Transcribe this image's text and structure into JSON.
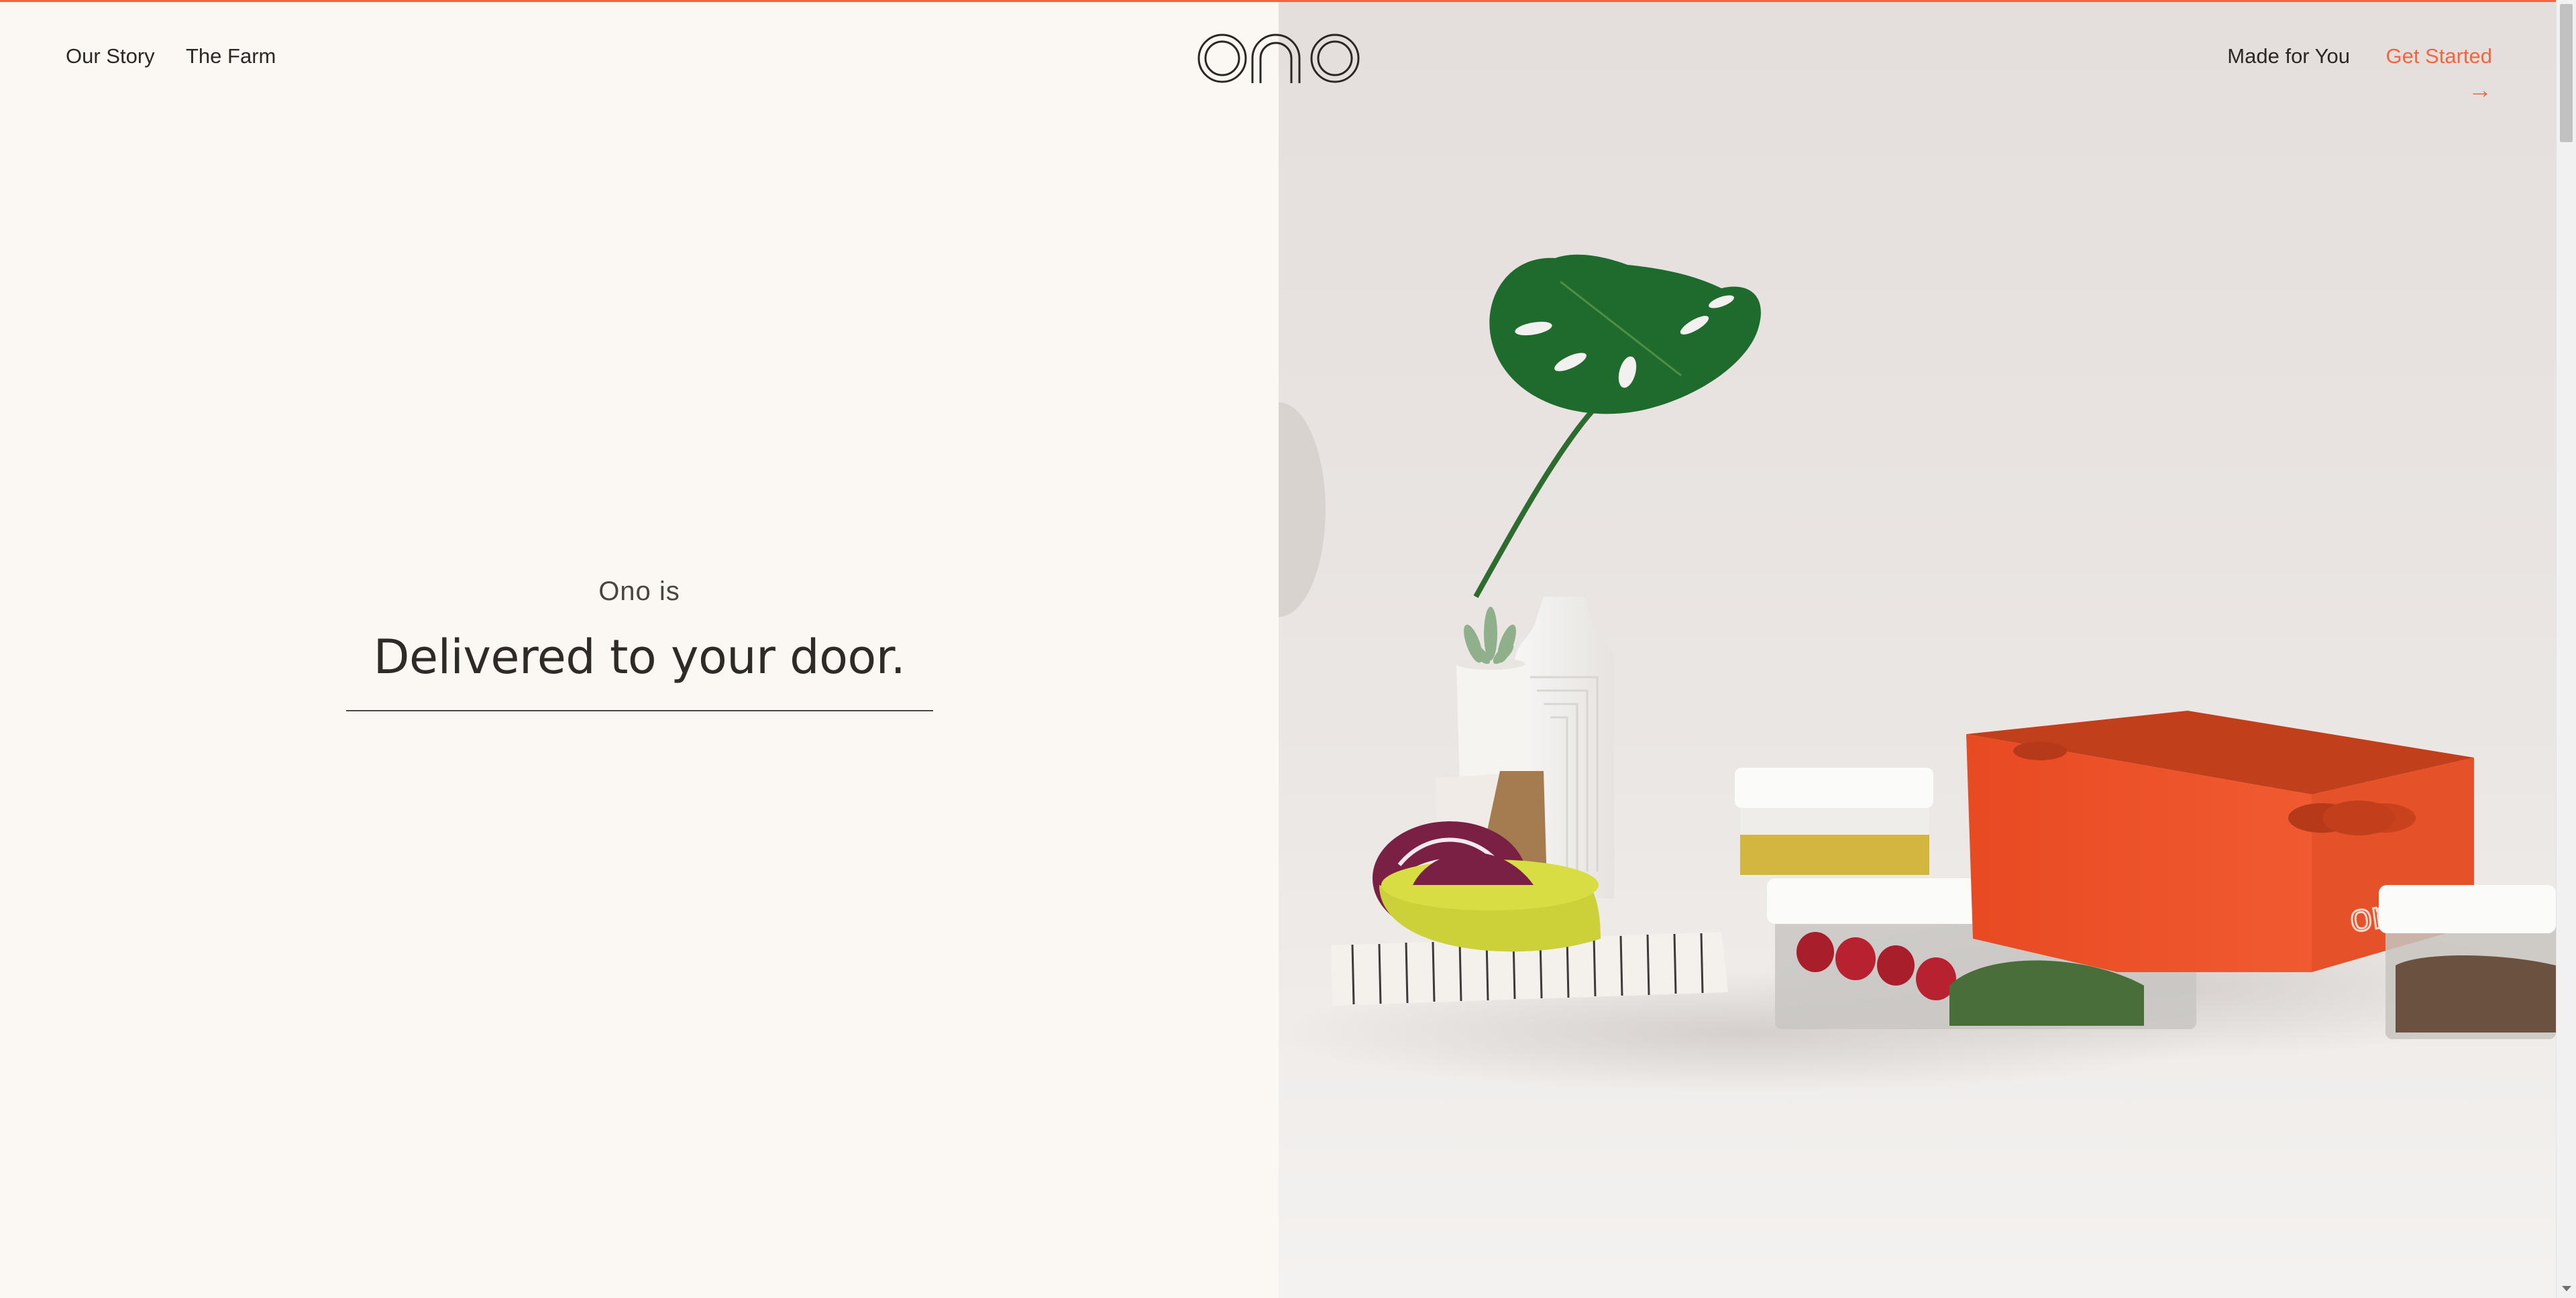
{
  "nav": {
    "left_links": [
      "Our Story",
      "The Farm"
    ],
    "right_link": "Made for You",
    "cta_label": "Get Started",
    "cta_icon": "arrow-right-icon",
    "logo_text": "ono"
  },
  "hero": {
    "intro": "Ono is",
    "headline": "Delivered to your door."
  },
  "colors": {
    "accent": "#f0663f",
    "background": "#fbf8f4",
    "text": "#2c2724"
  }
}
